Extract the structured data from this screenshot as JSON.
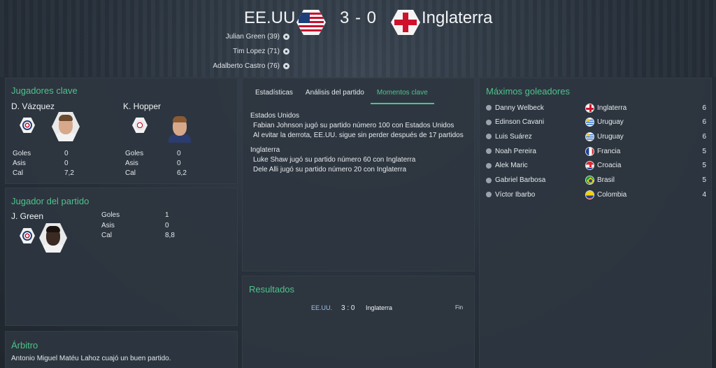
{
  "match": {
    "home_team": "EE.UU.",
    "away_team": "Inglaterra",
    "score": "3 - 0",
    "scorers": [
      "Julian Green (39)",
      "Tim Lopez (71)",
      "Adalberto Castro (76)"
    ]
  },
  "key_players": {
    "title": "Jugadores clave",
    "home": {
      "name": "D. Vázquez",
      "goals_label": "Goles",
      "goals": "0",
      "assists_label": "Asis",
      "assists": "0",
      "rating_label": "Cal",
      "rating": "7,2"
    },
    "away": {
      "name": "K. Hopper",
      "goals_label": "Goles",
      "goals": "0",
      "assists_label": "Asis",
      "assists": "0",
      "rating_label": "Cal",
      "rating": "6,2"
    }
  },
  "player_of_match": {
    "title": "Jugador del partido",
    "name": "J. Green",
    "goals_label": "Goles",
    "goals": "1",
    "assists_label": "Asis",
    "assists": "0",
    "rating_label": "Cal",
    "rating": "8,8"
  },
  "referee": {
    "title": "Árbitro",
    "text": "Antonio Miguel Matéu Lahoz cuajó un buen partido."
  },
  "tabs": [
    {
      "label": "Estadísticas"
    },
    {
      "label": "Análisis del partido"
    },
    {
      "label": "Momentos clave",
      "active": true
    }
  ],
  "moments": {
    "home_team": "Estados Unidos",
    "home_items": [
      "Fabian Johnson jugó su partido número 100 con Estados Unidos",
      "Al evitar la derrota, EE.UU. sigue sin perder después de 17 partidos"
    ],
    "away_team": "Inglaterra",
    "away_items": [
      "Luke Shaw jugó su partido número 60 con Inglaterra",
      "Dele Alli jugó su partido número 20 con Inglaterra"
    ]
  },
  "results": {
    "title": "Resultados",
    "home": "EE.UU.",
    "score": "3 : 0",
    "away": "Inglaterra",
    "status": "Fin"
  },
  "top_scorers": {
    "title": "Máximos goleadores",
    "rows": [
      {
        "name": "Danny Welbeck",
        "country": "Inglaterra",
        "goals": "6",
        "flag": "england"
      },
      {
        "name": "Edinson Cavani",
        "country": "Uruguay",
        "goals": "6",
        "flag": "uruguay"
      },
      {
        "name": "Luis Suárez",
        "country": "Uruguay",
        "goals": "6",
        "flag": "uruguay"
      },
      {
        "name": "Noah Pereira",
        "country": "Francia",
        "goals": "5",
        "flag": "france"
      },
      {
        "name": "Alek Maric",
        "country": "Croacia",
        "goals": "5",
        "flag": "croatia"
      },
      {
        "name": "Gabriel Barbosa",
        "country": "Brasil",
        "goals": "5",
        "flag": "brazil"
      },
      {
        "name": "Víctor Ibarbo",
        "country": "Colombia",
        "goals": "4",
        "flag": "colombia"
      }
    ]
  },
  "colors": {
    "accent": "#4fc28b",
    "panel": "#2e3640",
    "home_link": "#9ec3f0"
  }
}
